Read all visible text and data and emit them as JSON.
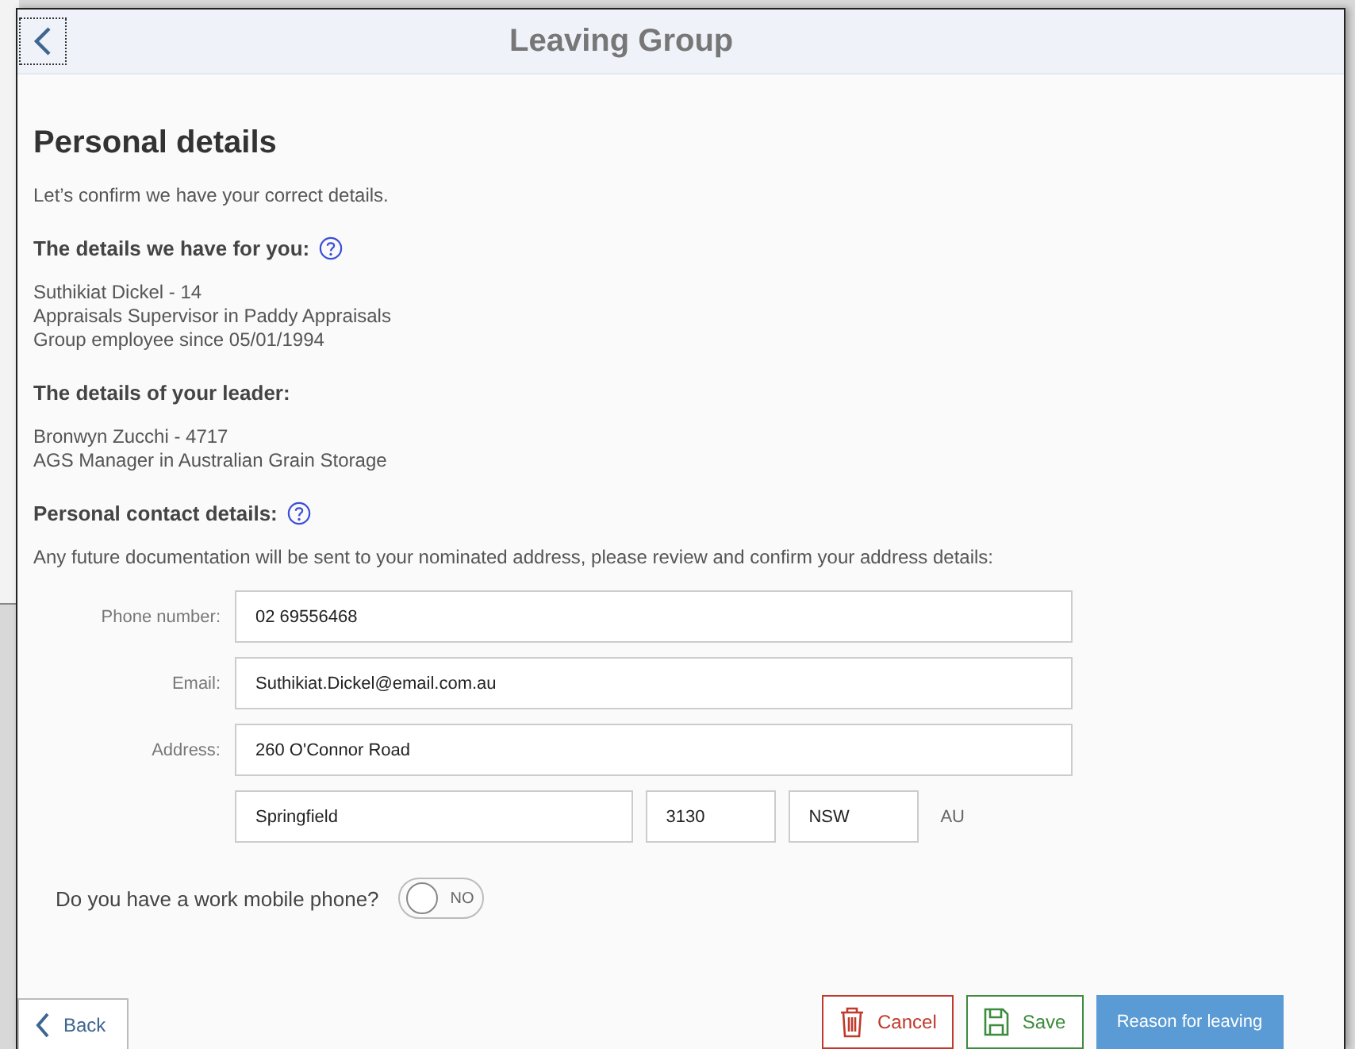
{
  "window": {
    "title": "Leaving Group"
  },
  "heading": "Personal details",
  "intro": "Let’s confirm we have your correct details.",
  "sections": [
    {
      "title": "The details we have for you:",
      "help": true,
      "lines": [
        "Suthikiat Dickel - 14",
        "Appraisals Supervisor in Paddy Appraisals",
        "Group employee since 05/01/1994"
      ]
    },
    {
      "title": "The details of your leader:",
      "help": false,
      "lines": [
        "Bronwyn Zucchi - 4717",
        "AGS Manager in Australian Grain Storage"
      ]
    },
    {
      "title": "Personal contact details:",
      "help": true,
      "lines": [
        "Any future documentation will be sent to your nominated address, please review and confirm your address details:"
      ]
    }
  ],
  "fields": [
    {
      "label": "Phone number:",
      "value": "02 69556468"
    },
    {
      "label": "Email:",
      "value": "Suthikiat.Dickel@email.com.au"
    },
    {
      "label": "Address:",
      "value": "260 O'Connor Road"
    }
  ],
  "address_line": {
    "city": "Springfield",
    "postcode": "3130",
    "state": "NSW",
    "country": "AU"
  },
  "mobile_question": {
    "label": "Do you have a work mobile phone?",
    "on": false,
    "toggle_text": "NO"
  },
  "buttons": [
    {
      "kind": "back",
      "label": "Back"
    },
    {
      "kind": "cancel",
      "label": "Cancel"
    },
    {
      "kind": "save",
      "label": "Save"
    },
    {
      "kind": "primary",
      "label": "Reason for leaving"
    }
  ]
}
